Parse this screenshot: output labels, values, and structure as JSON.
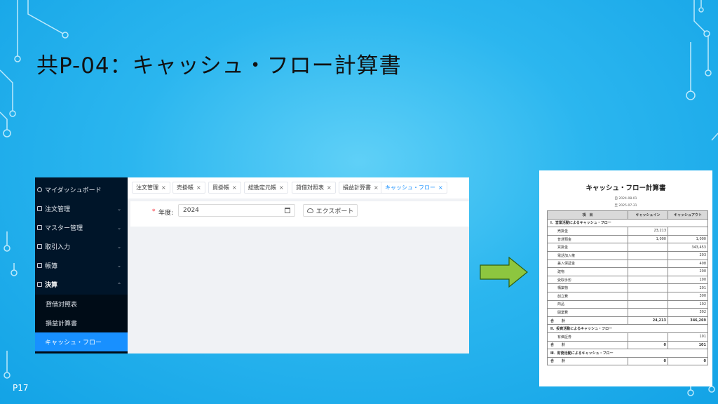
{
  "slide": {
    "title": "共P-04：キャッシュ・フロー計算書",
    "page_number": "P17"
  },
  "colors": {
    "background": "#2bb6ef",
    "sidebar": "#001529",
    "accent": "#1890ff",
    "arrow": "#8dc63f"
  },
  "app": {
    "sidebar": {
      "items": [
        {
          "label": "マイダッシュボード",
          "icon": "dashboard-icon",
          "chevron": ""
        },
        {
          "label": "注文管理",
          "icon": "file-icon",
          "chevron": "⌄"
        },
        {
          "label": "マスター管理",
          "icon": "book-icon",
          "chevron": "⌄"
        },
        {
          "label": "取引入力",
          "icon": "edit-icon",
          "chevron": "⌄"
        },
        {
          "label": "帳簿",
          "icon": "ledger-icon",
          "chevron": "⌄"
        },
        {
          "label": "決算",
          "icon": "settlement-icon",
          "chevron": "⌃"
        }
      ],
      "sub_items": [
        {
          "label": "貸借対照表"
        },
        {
          "label": "損益計算書"
        },
        {
          "label": "キャッシュ・フロー"
        }
      ]
    },
    "tabs": [
      {
        "label": "注文管理",
        "close": "×"
      },
      {
        "label": "売掛帳",
        "close": "×"
      },
      {
        "label": "買掛帳",
        "close": "×"
      },
      {
        "label": "総勘定元帳",
        "close": "×"
      },
      {
        "label": "貸借対照表",
        "close": "×"
      },
      {
        "label": "損益計算書",
        "close": "×"
      },
      {
        "label": "キャッシュ・フロー",
        "close": "×"
      }
    ],
    "toolbar": {
      "required_mark": "*",
      "year_label": "年度:",
      "year_value": "2024",
      "export_label": "エクスポート"
    }
  },
  "report": {
    "title": "キャッシュ・フロー計算書",
    "date_from": "自 2024-08-01",
    "date_to": "至 2025-07-31",
    "headers": [
      "項　目",
      "キャッシュイン",
      "キャッシュアウト"
    ],
    "rows": [
      {
        "kind": "sec",
        "item": "Ⅰ．営業活動によるキャッシュ・フロー",
        "in": "",
        "out": ""
      },
      {
        "kind": "item",
        "item": "売掛金",
        "in": "23,213",
        "out": ""
      },
      {
        "kind": "item",
        "item": "普通預金",
        "in": "1,000",
        "out": "1,000"
      },
      {
        "kind": "item",
        "item": "買掛金",
        "in": "",
        "out": "343,453"
      },
      {
        "kind": "item",
        "item": "電話加入権",
        "in": "",
        "out": "203"
      },
      {
        "kind": "item",
        "item": "差入保証金",
        "in": "",
        "out": "408"
      },
      {
        "kind": "item",
        "item": "建物",
        "in": "",
        "out": "200"
      },
      {
        "kind": "item",
        "item": "受取手形",
        "in": "",
        "out": "100"
      },
      {
        "kind": "item",
        "item": "構築物",
        "in": "",
        "out": "201"
      },
      {
        "kind": "item",
        "item": "創立費",
        "in": "",
        "out": "300"
      },
      {
        "kind": "item",
        "item": "商品",
        "in": "",
        "out": "102"
      },
      {
        "kind": "item",
        "item": "開業費",
        "in": "",
        "out": "302"
      },
      {
        "kind": "total",
        "item": "合　計",
        "in": "24,213",
        "out": "346,269"
      },
      {
        "kind": "sec",
        "item": "Ⅱ．投資活動によるキャッシュ・フロー",
        "in": "",
        "out": ""
      },
      {
        "kind": "item",
        "item": "有価証券",
        "in": "",
        "out": "101"
      },
      {
        "kind": "total",
        "item": "合　計",
        "in": "0",
        "out": "101"
      },
      {
        "kind": "sec",
        "item": "Ⅲ．財務活動によるキャッシュ・フロー",
        "in": "",
        "out": ""
      },
      {
        "kind": "total",
        "item": "合　計",
        "in": "0",
        "out": "0"
      }
    ]
  }
}
